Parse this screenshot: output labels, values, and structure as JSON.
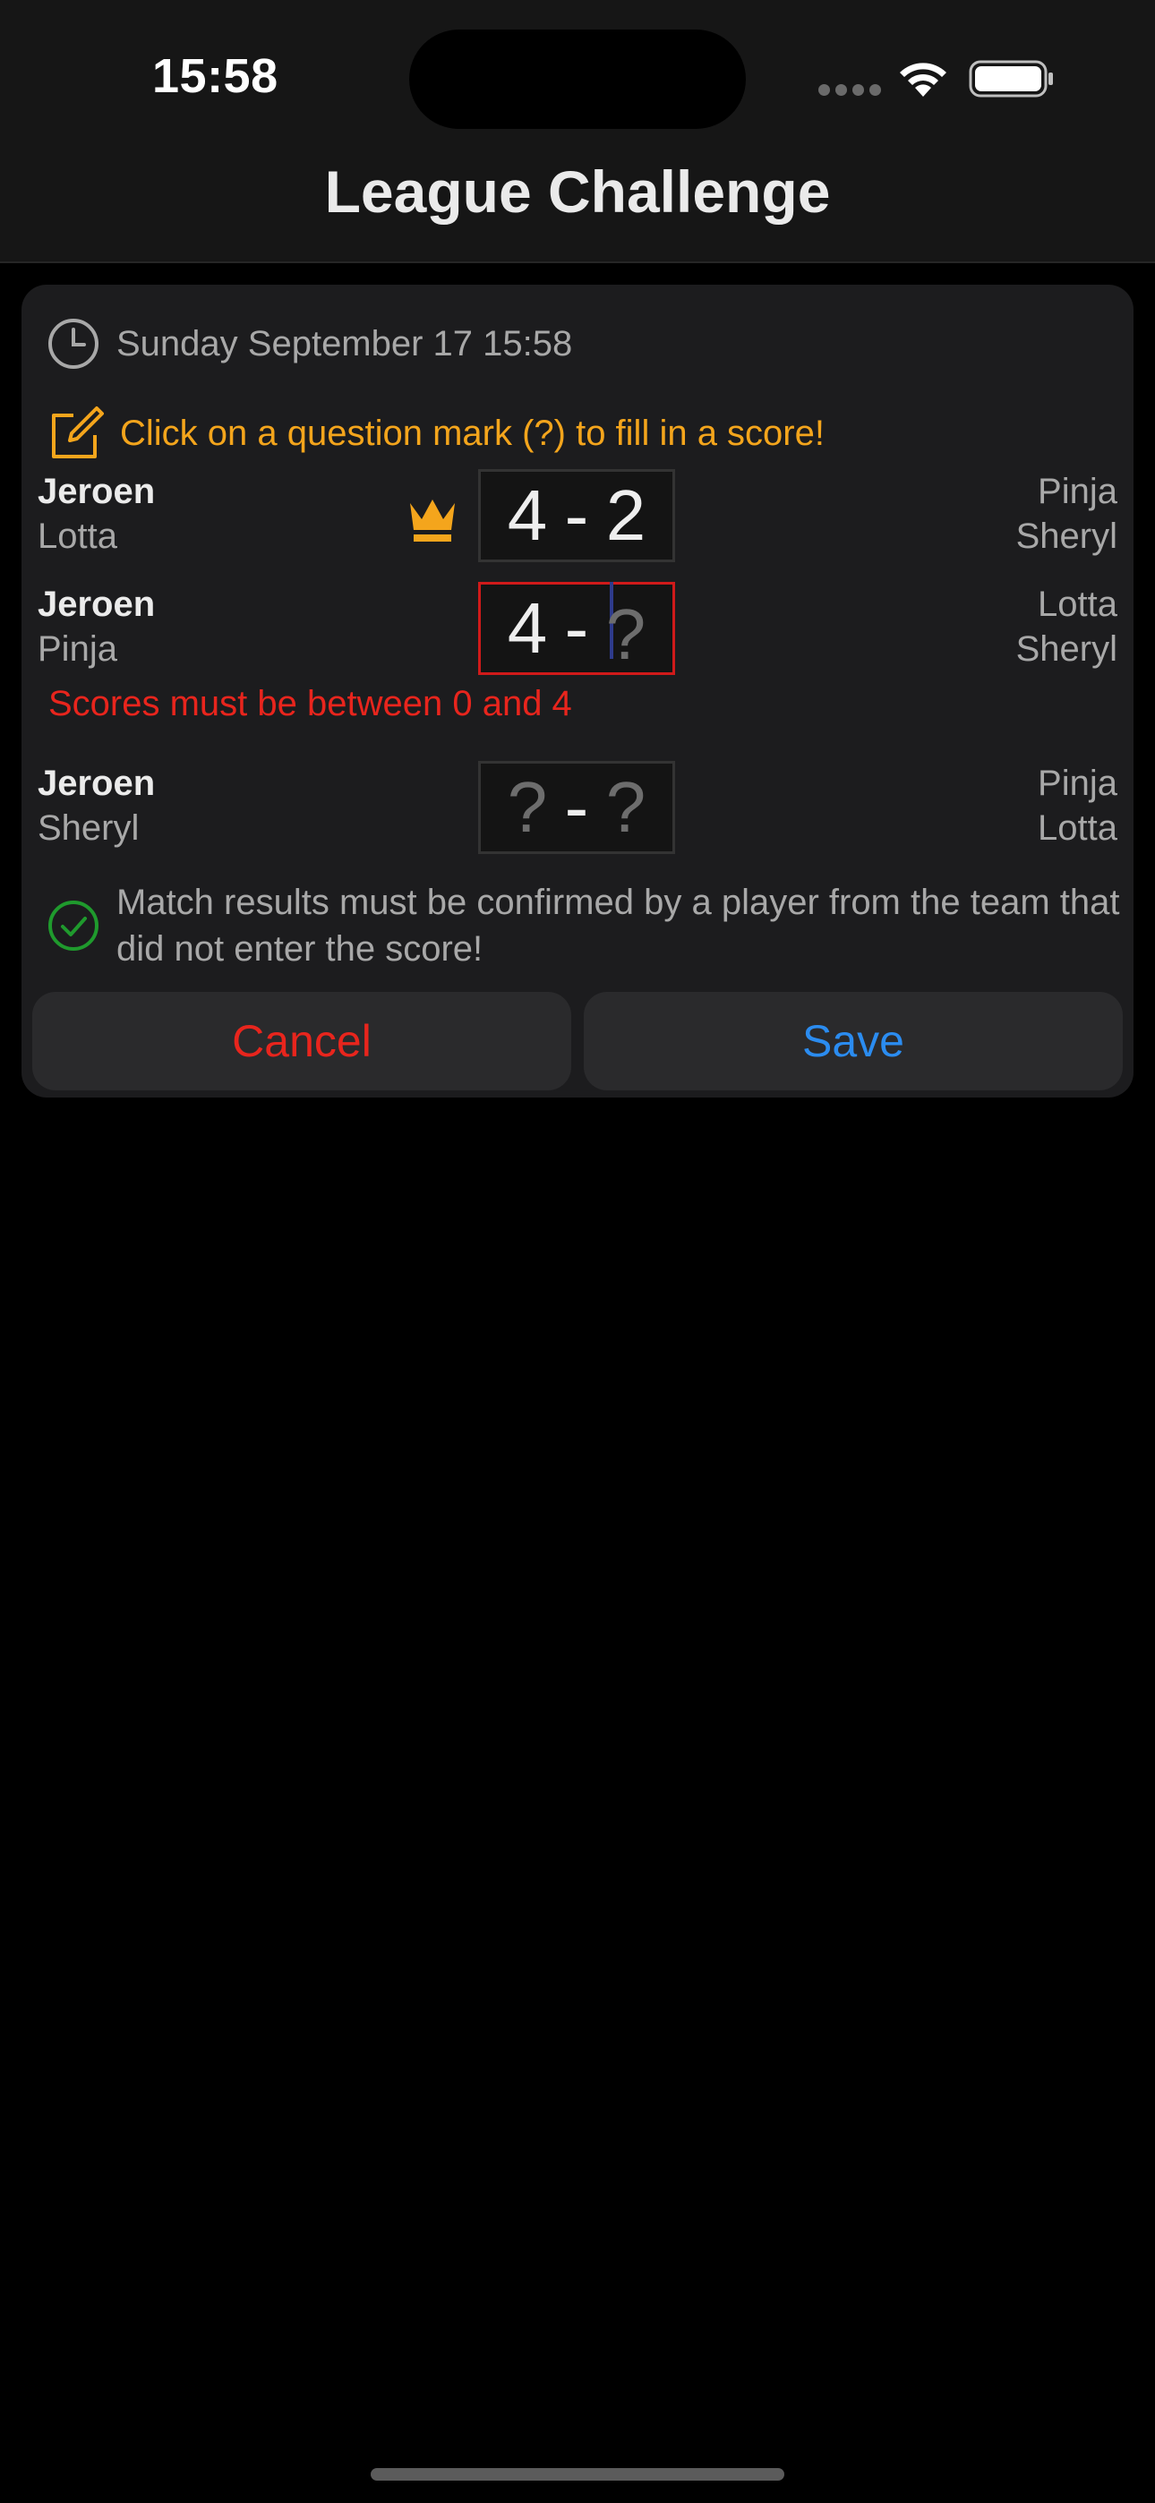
{
  "status_bar": {
    "time": "15:58"
  },
  "nav": {
    "title": "League Challenge"
  },
  "card": {
    "date_text": "Sunday September 17 15:58",
    "hint_text": "Click on a question mark (?) to fill in a score!",
    "matches": [
      {
        "home": [
          "Jeroen",
          "Lotta"
        ],
        "away": [
          "Pinja",
          "Sheryl"
        ],
        "score_home": "4",
        "score_away": "2",
        "winner_crown": true
      },
      {
        "home": [
          "Jeroen",
          "Pinja"
        ],
        "away": [
          "Lotta",
          "Sheryl"
        ],
        "score_home": "4",
        "score_away": "?",
        "error": true
      },
      {
        "home": [
          "Jeroen",
          "Sheryl"
        ],
        "away": [
          "Pinja",
          "Lotta"
        ],
        "score_home": "?",
        "score_away": "?"
      }
    ],
    "score_separator": "-",
    "error_message": "Scores must be between 0 and 4",
    "confirm_text": "Match results must be confirmed by a player from the team that did not enter the score!",
    "cancel_label": "Cancel",
    "save_label": "Save"
  },
  "icons": {
    "date": "clock-icon",
    "hint": "edit-icon",
    "winner": "crown-icon",
    "confirm": "checkmark-circle-icon"
  },
  "colors": {
    "accent_orange": "#f4a51c",
    "error_red": "#e8251d",
    "save_blue": "#2b8cf0",
    "confirm_green": "#1f9a2d"
  }
}
